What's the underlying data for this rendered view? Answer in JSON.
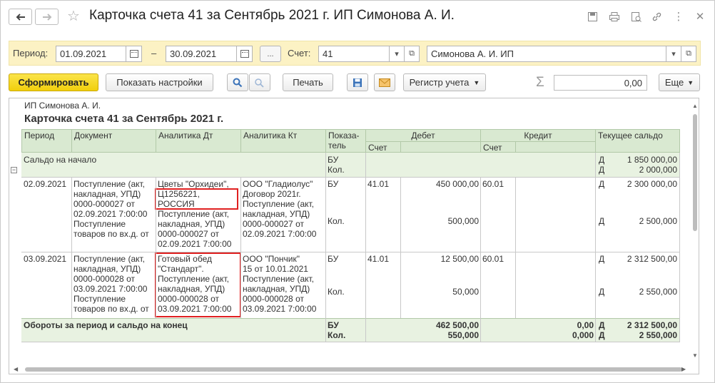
{
  "window": {
    "title": "Карточка счета 41 за Сентябрь 2021 г. ИП Симонова А. И."
  },
  "filter": {
    "period_label": "Период:",
    "date_from": "01.09.2021",
    "dash": "–",
    "date_to": "30.09.2021",
    "choose_btn": "...",
    "account_label": "Счет:",
    "account": "41",
    "organization": "Симонова А. И. ИП"
  },
  "toolbar": {
    "generate": "Сформировать",
    "show_settings": "Показать настройки",
    "print": "Печать",
    "register": "Регистр учета",
    "sigma": "Σ",
    "sum_value": "0,00",
    "more": "Еще"
  },
  "report": {
    "org": "ИП Симонова А. И.",
    "title": "Карточка счета 41 за Сентябрь 2021 г.",
    "headers": {
      "period": "Период",
      "document": "Документ",
      "an_dt": "Аналитика Дт",
      "an_kt": "Аналитика Кт",
      "pokazatel": "Показа-\nтель",
      "debet": "Дебет",
      "kredit": "Кредит",
      "saldo": "Текущее сальдо",
      "schet_d": "Счет",
      "schet_k": "Счет"
    },
    "opening": {
      "label": "Сальдо на начало",
      "ind": "БУ\nКол.",
      "dk": "Д\nД",
      "sum": "1 850 000,00\n2 000,000"
    },
    "rows": [
      {
        "period": "02.09.2021",
        "document": "Поступление (акт,\nнакладная, УПД)\n0000-000027 от\n02.09.2021 7:00:00\nПоступление\nтоваров по вх.д.  от",
        "an_dt_top": "Цветы \"Орхидеи\",",
        "an_dt_boxed": "Ц1256221,\nРОССИЯ",
        "an_dt_rest": "Поступление (акт,\nнакладная, УПД)\n0000-000027 от\n02.09.2021 7:00:00",
        "an_kt": "ООО \"Гладиолус\"\nДоговор 2021г.\nПоступление (акт,\nнакладная, УПД)\n0000-000027 от\n02.09.2021 7:00:00",
        "ind1": "БУ",
        "ind2": "Кол.",
        "d_acc": "41.01",
        "d_sum": "450 000,00",
        "d_qty": "500,000",
        "k_acc": "60.01",
        "dk1": "Д",
        "dk2": "Д",
        "s1": "2 300 000,00",
        "s2": "2 500,000"
      },
      {
        "period": "03.09.2021",
        "document": "Поступление (акт,\nнакладная, УПД)\n0000-000028 от\n03.09.2021 7:00:00\nПоступление\nтоваров по вх.д.  от",
        "an_dt": "Готовый обед\n\"Стандарт\".\nПоступление (акт,\nнакладная, УПД)\n0000-000028 от\n03.09.2021 7:00:00",
        "an_kt": "ООО \"Пончик\"\n15 от 10.01.2021\nПоступление (акт,\nнакладная, УПД)\n0000-000028 от\n03.09.2021 7:00:00",
        "ind1": "БУ",
        "ind2": "Кол.",
        "d_acc": "41.01",
        "d_sum": "12 500,00",
        "d_qty": "50,000",
        "k_acc": "60.01",
        "dk1": "Д",
        "dk2": "Д",
        "s1": "2 312 500,00",
        "s2": "2 550,000"
      }
    ],
    "totals": {
      "label": "Обороты за период и сальдо на конец",
      "ind": "БУ\nКол.",
      "d": "462 500,00\n550,000",
      "k": "0,00\n0,000",
      "dk": "Д\nД",
      "s": "2 312 500,00\n2 550,000"
    }
  }
}
